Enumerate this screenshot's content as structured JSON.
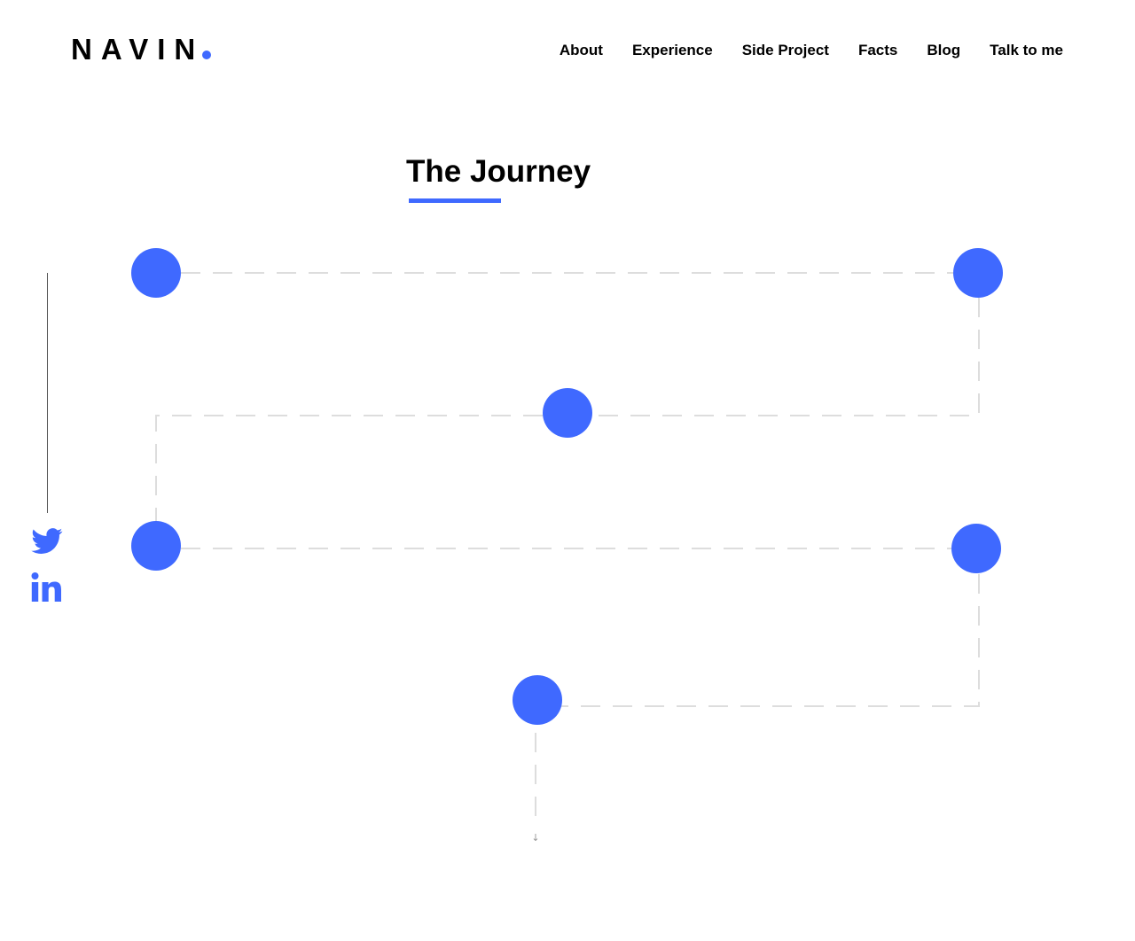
{
  "brand": {
    "name": "NAVIN",
    "accent": "#3f69ff"
  },
  "nav": {
    "items": [
      {
        "label": "About"
      },
      {
        "label": "Experience"
      },
      {
        "label": "Side Project"
      },
      {
        "label": "Facts"
      },
      {
        "label": "Blog"
      },
      {
        "label": "Talk to me"
      }
    ]
  },
  "journey": {
    "title": "The Journey",
    "milestone_count": 6,
    "arrow_glyph": "↓"
  },
  "social": {
    "icons": [
      "twitter-icon",
      "linkedin-icon"
    ]
  }
}
